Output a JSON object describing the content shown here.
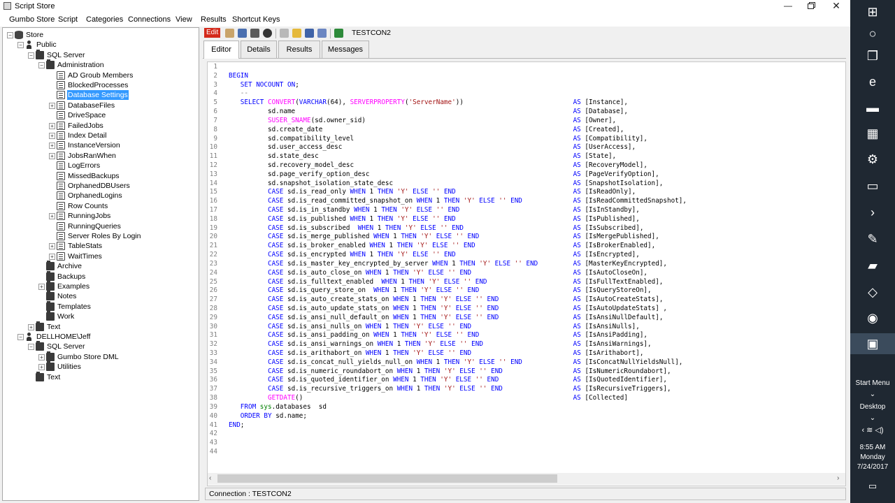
{
  "window": {
    "title": "Script Store",
    "controls": {
      "minimize": "—",
      "maximize": "",
      "close": "✕"
    }
  },
  "menu": [
    "Gumbo Store",
    "Script",
    "Categories",
    "Connections",
    "View",
    "Results",
    "Shortcut Keys"
  ],
  "tree": [
    {
      "label": "Store",
      "level": 0,
      "toggle": "−",
      "icon": "db"
    },
    {
      "label": "Public",
      "level": 1,
      "toggle": "−",
      "icon": "person"
    },
    {
      "label": "SQL Server",
      "level": 2,
      "toggle": "−",
      "icon": "folder"
    },
    {
      "label": "Administration",
      "level": 3,
      "toggle": "−",
      "icon": "folder"
    },
    {
      "label": "AD Groub Members",
      "level": 4,
      "toggle": "",
      "icon": "script"
    },
    {
      "label": "BlockedProcesses",
      "level": 4,
      "toggle": "",
      "icon": "script"
    },
    {
      "label": "Database Settings",
      "level": 4,
      "toggle": "",
      "icon": "script",
      "selected": true
    },
    {
      "label": "DatabaseFiles",
      "level": 4,
      "toggle": "+",
      "icon": "script"
    },
    {
      "label": "DriveSpace",
      "level": 4,
      "toggle": "",
      "icon": "script"
    },
    {
      "label": "FailedJobs",
      "level": 4,
      "toggle": "+",
      "icon": "script"
    },
    {
      "label": "Index Detail",
      "level": 4,
      "toggle": "+",
      "icon": "script"
    },
    {
      "label": "InstanceVersion",
      "level": 4,
      "toggle": "+",
      "icon": "script"
    },
    {
      "label": "JobsRanWhen",
      "level": 4,
      "toggle": "+",
      "icon": "script"
    },
    {
      "label": "LogErrors",
      "level": 4,
      "toggle": "",
      "icon": "script"
    },
    {
      "label": "MissedBackups",
      "level": 4,
      "toggle": "",
      "icon": "script"
    },
    {
      "label": "OrphanedDBUsers",
      "level": 4,
      "toggle": "",
      "icon": "script"
    },
    {
      "label": "OrphanedLogins",
      "level": 4,
      "toggle": "",
      "icon": "script"
    },
    {
      "label": "Row Counts",
      "level": 4,
      "toggle": "",
      "icon": "script"
    },
    {
      "label": "RunningJobs",
      "level": 4,
      "toggle": "+",
      "icon": "script"
    },
    {
      "label": "RunningQueries",
      "level": 4,
      "toggle": "",
      "icon": "script"
    },
    {
      "label": "Server Roles By Login",
      "level": 4,
      "toggle": "",
      "icon": "script"
    },
    {
      "label": "TableStats",
      "level": 4,
      "toggle": "+",
      "icon": "script"
    },
    {
      "label": "WaitTimes",
      "level": 4,
      "toggle": "+",
      "icon": "script"
    },
    {
      "label": "Archive",
      "level": 3,
      "toggle": "",
      "icon": "folder"
    },
    {
      "label": "Backups",
      "level": 3,
      "toggle": "",
      "icon": "folder"
    },
    {
      "label": "Examples",
      "level": 3,
      "toggle": "+",
      "icon": "folder"
    },
    {
      "label": "Notes",
      "level": 3,
      "toggle": "",
      "icon": "folder"
    },
    {
      "label": "Templates",
      "level": 3,
      "toggle": "",
      "icon": "folder"
    },
    {
      "label": "Work",
      "level": 3,
      "toggle": "",
      "icon": "folder"
    },
    {
      "label": "Text",
      "level": 2,
      "toggle": "+",
      "icon": "folder"
    },
    {
      "label": "DELLHOME\\Jeff",
      "level": 1,
      "toggle": "−",
      "icon": "person"
    },
    {
      "label": "SQL Server",
      "level": 2,
      "toggle": "−",
      "icon": "folder"
    },
    {
      "label": "Gumbo Store DML",
      "level": 3,
      "toggle": "+",
      "icon": "folder"
    },
    {
      "label": "Utilities",
      "level": 3,
      "toggle": "+",
      "icon": "folder"
    },
    {
      "label": "Text",
      "level": 2,
      "toggle": "",
      "icon": "folder"
    }
  ],
  "toolbar": {
    "edit_label": "Edit",
    "connection": "TESTCON2"
  },
  "tabs": [
    "Editor",
    "Details",
    "Results",
    "Messages"
  ],
  "code": [
    "",
    "BEGIN",
    "   SET NOCOUNT ON;",
    "   --",
    "   SELECT CONVERT(VARCHAR(64), SERVERPROPERTY('ServerName'))                            AS [Instance],",
    "          sd.name                                                                       AS [Database],",
    "          SUSER_SNAME(sd.owner_sid)                                                     AS [Owner],",
    "          sd.create_date                                                                AS [Created],",
    "          sd.compatibility_level                                                        AS [Compatibility],",
    "          sd.user_access_desc                                                           AS [UserAccess],",
    "          sd.state_desc                                                                 AS [State],",
    "          sd.recovery_model_desc                                                        AS [RecoveryModel],",
    "          sd.page_verify_option_desc                                                    AS [PageVerifyOption],",
    "          sd.snapshot_isolation_state_desc                                              AS [SnapshotIsolation],",
    "          CASE sd.is_read_only WHEN 1 THEN 'Y' ELSE '' END                              AS [IsReadOnly],",
    "          CASE sd.is_read_committed_snapshot_on WHEN 1 THEN 'Y' ELSE '' END             AS [IsReadCommittedSnapshot],",
    "          CASE sd.is_in_standby WHEN 1 THEN 'Y' ELSE '' END                             AS [IsInStandby],",
    "          CASE sd.is_published WHEN 1 THEN 'Y' ELSE '' END                              AS [IsPublished],",
    "          CASE sd.is_subscribed  WHEN 1 THEN 'Y' ELSE '' END                            AS [IsSubscribed],",
    "          CASE sd.is_merge_published WHEN 1 THEN 'Y' ELSE '' END                        AS [IsMergePublished],",
    "          CASE sd.is_broker_enabled WHEN 1 THEN 'Y' ELSE '' END                         AS [IsBrokerEnabled],",
    "          CASE sd.is_encrypted WHEN 1 THEN 'Y' ELSE '' END                              AS [IsEncrypted],",
    "          CASE sd.is_master_key_encrypted_by_server WHEN 1 THEN 'Y' ELSE '' END         AS [MasterKeyEncrypted],",
    "          CASE sd.is_auto_close_on WHEN 1 THEN 'Y' ELSE '' END                          AS [IsAutoCloseOn],",
    "          CASE sd.is_fulltext_enabled  WHEN 1 THEN 'Y' ELSE '' END                      AS [IsFullTextEnabled],",
    "          CASE sd.is_query_store_on  WHEN 1 THEN 'Y' ELSE '' END                        AS [IsQueryStoreOn],",
    "          CASE sd.is_auto_create_stats_on WHEN 1 THEN 'Y' ELSE '' END                   AS [IsAutoCreateStats],",
    "          CASE sd.is_auto_update_stats_on WHEN 1 THEN 'Y' ELSE '' END                   AS [IsAutoUpdateStats] ,",
    "          CASE sd.is_ansi_null_default_on WHEN 1 THEN 'Y' ELSE '' END                   AS [IsAnsiNullDefault],",
    "          CASE sd.is_ansi_nulls_on WHEN 1 THEN 'Y' ELSE '' END                          AS [IsAnsiNulls],",
    "          CASE sd.is_ansi_padding_on WHEN 1 THEN 'Y' ELSE '' END                        AS [IsAnsiPadding],",
    "          CASE sd.is_ansi_warnings_on WHEN 1 THEN 'Y' ELSE '' END                       AS [IsAnsiWarnings],",
    "          CASE sd.is_arithabort_on WHEN 1 THEN 'Y' ELSE '' END                          AS [IsArithabort],",
    "          CASE sd.is_concat_null_yields_null_on WHEN 1 THEN 'Y' ELSE '' END             AS [IsConcatNullYieldsNull],",
    "          CASE sd.is_numeric_roundabort_on WHEN 1 THEN 'Y' ELSE '' END                  AS [IsNumericRoundabort],",
    "          CASE sd.is_quoted_identifier_on WHEN 1 THEN 'Y' ELSE '' END                   AS [IsQuotedIdentifier],",
    "          CASE sd.is_recursive_triggers_on WHEN 1 THEN 'Y' ELSE '' END                  AS [IsRecursiveTriggers],",
    "          GETDATE()                                                                     AS [Collected]",
    "   FROM sys.databases  sd",
    "   ORDER BY sd.name;",
    "END;",
    "",
    "",
    ""
  ],
  "status": {
    "connection_text": "Connection : TESTCON2"
  },
  "taskbar": {
    "apps": [
      "windows-logo",
      "cortana",
      "task-view",
      "edge",
      "file-explorer",
      "calculator",
      "settings",
      "command-prompt",
      "powershell",
      "tool-app",
      "red-app",
      "visual-studio",
      "network-app",
      "script-store"
    ],
    "start_menu": "Start Menu",
    "desktop": "Desktop",
    "time": "8:55 AM",
    "day": "Monday",
    "date": "7/24/2017"
  },
  "colors": {
    "selection": "#3399ff",
    "edit_badge": "#d42a1c",
    "taskbar": "#1f2832",
    "keyword": "#0000ff",
    "function": "#ff00ff",
    "string": "#a31515"
  }
}
